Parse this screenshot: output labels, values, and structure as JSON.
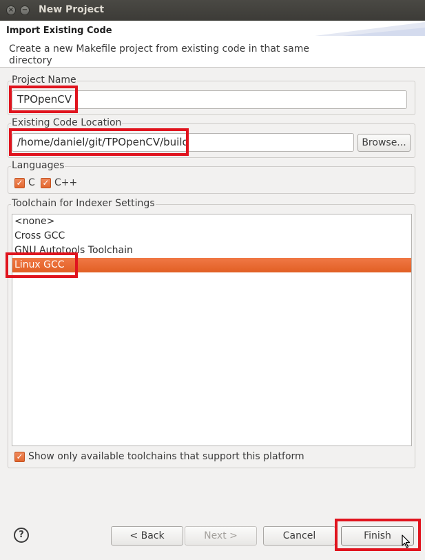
{
  "window": {
    "title": "New Project",
    "close_glyph": "×",
    "minimize_glyph": "−"
  },
  "banner": {
    "title": "Import Existing Code",
    "description": "Create a new Makefile project from existing code in that same directory"
  },
  "project_name": {
    "label": "Project Name",
    "value": "TPOpenCV"
  },
  "code_location": {
    "label": "Existing Code Location",
    "value": "/home/daniel/git/TPOpenCV/build",
    "browse_label": "Browse..."
  },
  "languages": {
    "label": "Languages",
    "items": [
      {
        "label": "C",
        "checked": true
      },
      {
        "label": "C++",
        "checked": true
      }
    ]
  },
  "toolchain": {
    "label": "Toolchain for Indexer Settings",
    "items": [
      "<none>",
      "Cross GCC",
      "GNU Autotools Toolchain",
      "Linux GCC"
    ],
    "selected_index": 3,
    "filter_label": "Show only available toolchains that support this platform",
    "filter_checked": true
  },
  "buttons": {
    "help": "?",
    "back": "< Back",
    "next": "Next >",
    "cancel": "Cancel",
    "finish": "Finish"
  },
  "colors": {
    "accent": "#e15f24",
    "highlight": "#e0141e"
  }
}
